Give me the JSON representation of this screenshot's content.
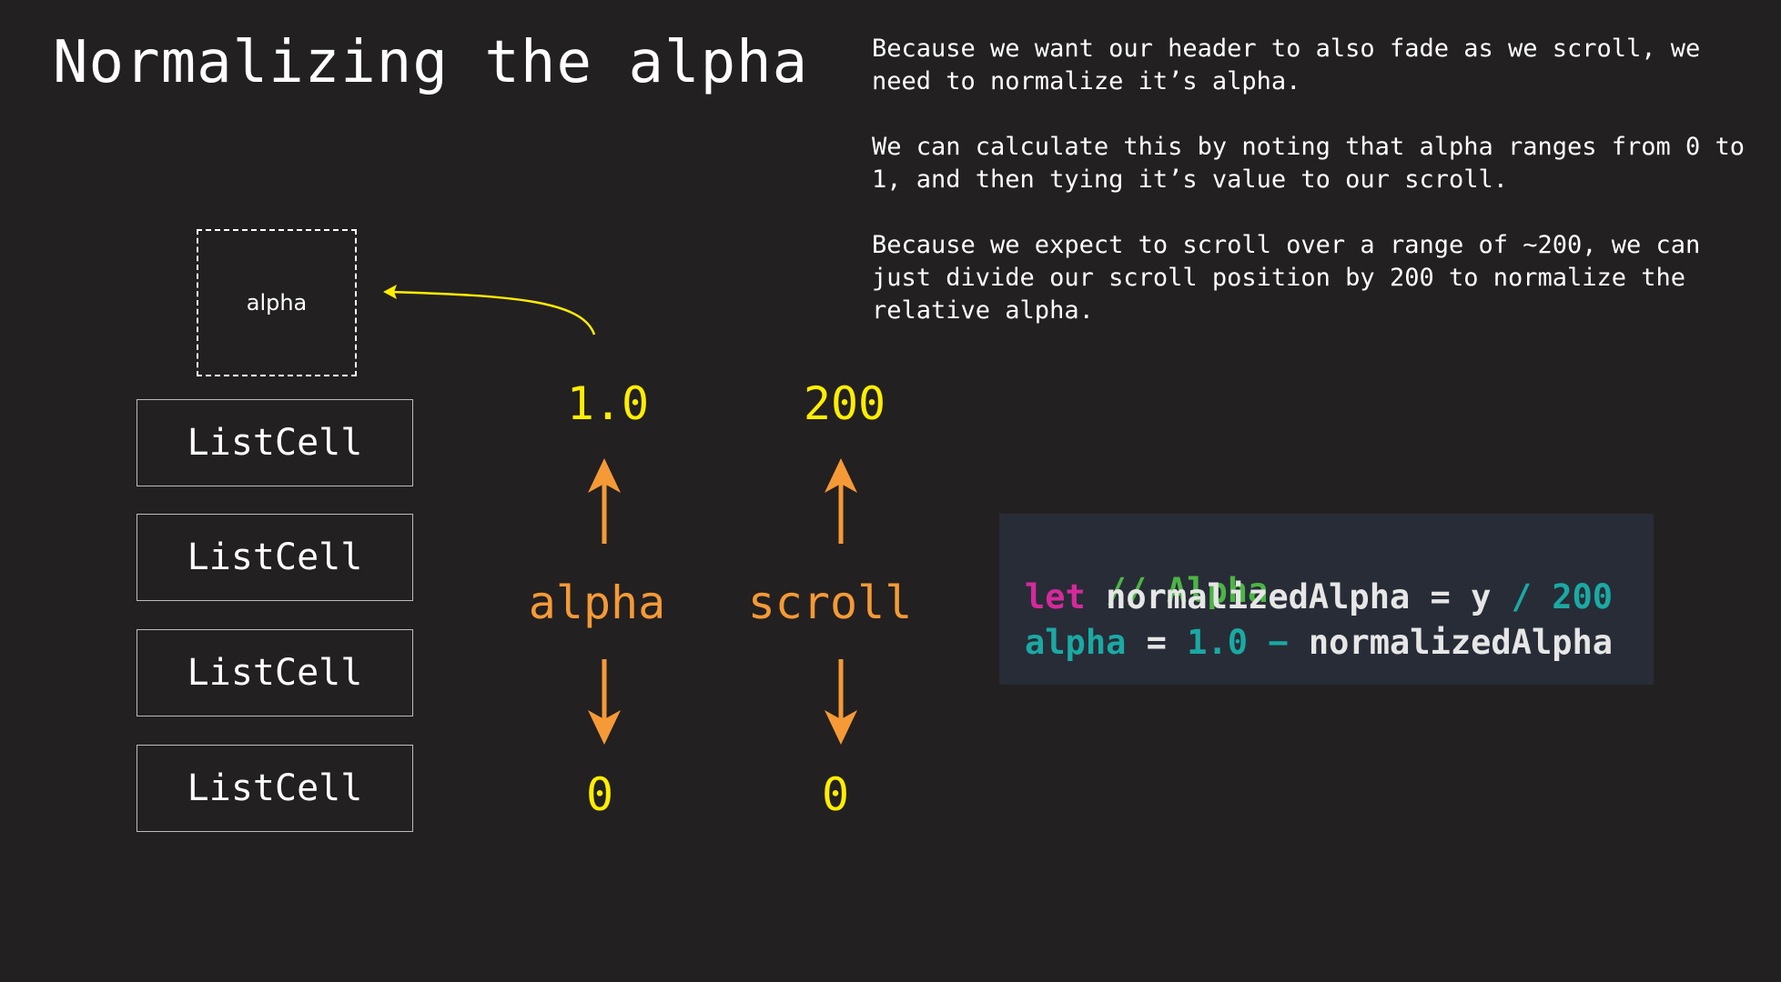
{
  "title": "Normalizing the alpha",
  "description": [
    "Because we want our header to also fade as we scroll, we need to normalize it’s alpha.",
    "We can calculate this by noting that alpha ranges from 0 to 1, and then tying it’s value to our scroll.",
    "Because we expect to scroll over a range of ~200, we can just divide our scroll position by 200 to normalize the relative alpha."
  ],
  "header_box": {
    "label": "alpha"
  },
  "list_cells": [
    "ListCell",
    "ListCell",
    "ListCell",
    "ListCell"
  ],
  "alpha_column": {
    "label": "alpha",
    "max": "1.0",
    "min": "0"
  },
  "scroll_column": {
    "label": "scroll",
    "max": "200",
    "min": "0"
  },
  "code": {
    "comment": "// Alpha",
    "line2": {
      "keyword": "let",
      "name": "normalizedAlpha",
      "eq": "=",
      "var": "y",
      "op": "/",
      "num": "200"
    },
    "line3": {
      "name": "alpha",
      "eq": "=",
      "num": "1.0",
      "op": "−",
      "var": "normalizedAlpha"
    }
  },
  "colors": {
    "background": "#232021",
    "value_yellow": "#ffee00",
    "arrow_orange": "#f59a36",
    "code_bg": "#282c37",
    "comment_green": "#4cb545",
    "keyword_pink": "#d6299c",
    "number_teal": "#1aa9a3"
  }
}
